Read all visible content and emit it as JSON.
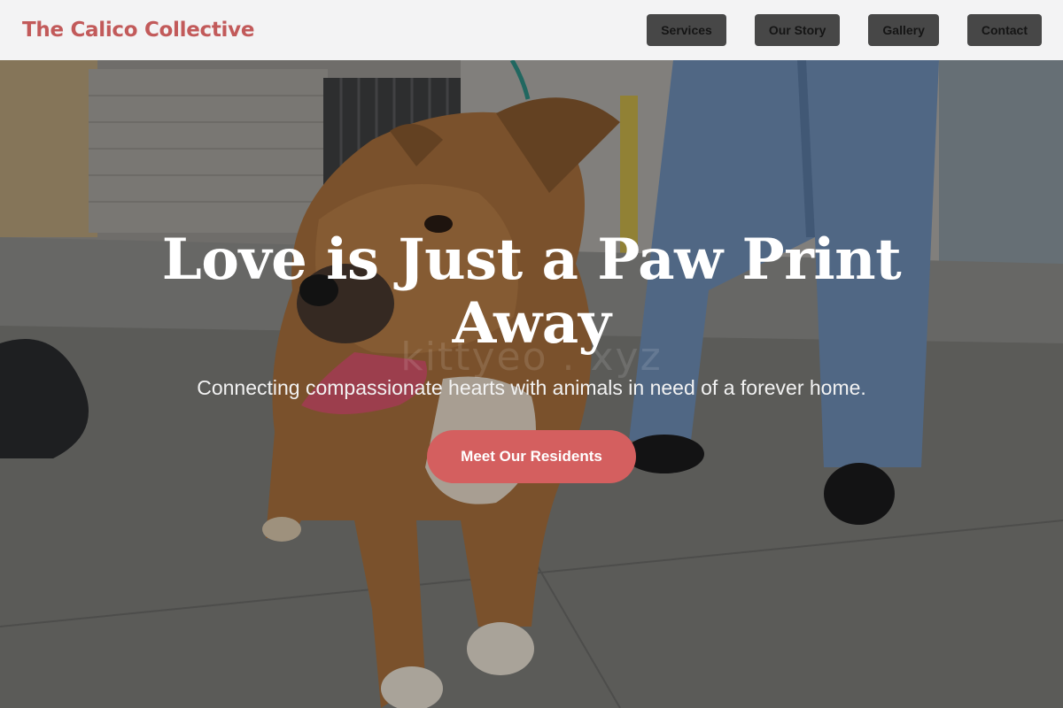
{
  "colors": {
    "brand": "#c25a5a",
    "nav_button_bg": "#474747",
    "cta_bg": "#d45f5f",
    "nav_bg": "#f3f3f4"
  },
  "nav": {
    "brand_name": "The Calico Collective",
    "links": [
      {
        "label": "Services"
      },
      {
        "label": "Our Story"
      },
      {
        "label": "Gallery"
      },
      {
        "label": "Contact"
      }
    ]
  },
  "hero": {
    "title": "Love is Just a Paw Print Away",
    "subtitle": "Connecting compassionate hearts with animals in need of a forever home.",
    "cta_label": "Meet Our Residents",
    "watermark": "kittyeo . xyz",
    "image_alt": "photo-of-brown-and-white-bulldog-on-leash"
  }
}
